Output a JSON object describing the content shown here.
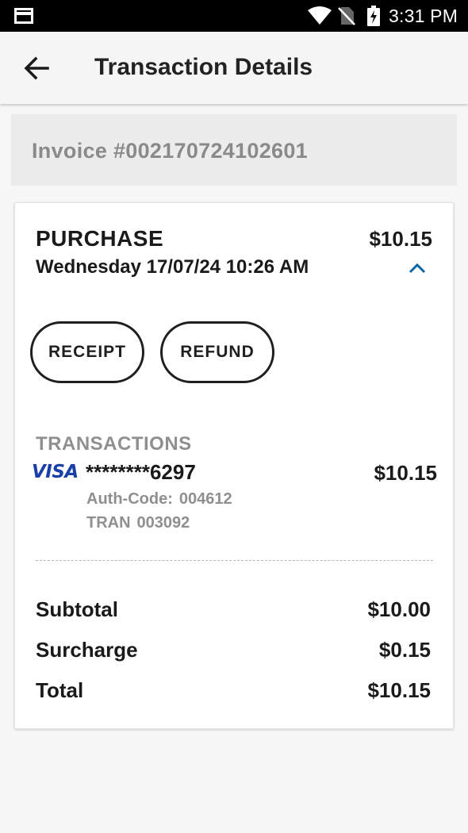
{
  "status_bar": {
    "time": "3:31 PM",
    "icons": [
      "card-icon",
      "wifi-icon",
      "no-sim-icon",
      "battery-charging-icon"
    ]
  },
  "app_bar": {
    "title": "Transaction Details",
    "back_icon": "arrow-left-icon"
  },
  "invoice": {
    "label": "Invoice #002170724102601"
  },
  "transaction": {
    "type": "PURCHASE",
    "amount": "$10.15",
    "datetime": "Wednesday 17/07/24 10:26 AM",
    "toggle_icon": "chevron-up-icon",
    "actions": {
      "receipt_label": "RECEIPT",
      "refund_label": "REFUND"
    }
  },
  "transactions_section": {
    "heading": "TRANSACTIONS",
    "items": [
      {
        "brand": "VISA",
        "card_number": "********6297",
        "amount": "$10.15",
        "auth_label": "Auth-Code:",
        "auth_value": "004612",
        "tran_label": "TRAN",
        "tran_value": "003092"
      }
    ]
  },
  "summary": {
    "subtotal_label": "Subtotal",
    "subtotal_value": "$10.00",
    "surcharge_label": "Surcharge",
    "surcharge_value": "$0.15",
    "total_label": "Total",
    "total_value": "$10.15"
  },
  "colors": {
    "accent": "#0a66a8",
    "visa_blue": "#1a3fa8",
    "muted_text": "#8f8f8f"
  }
}
